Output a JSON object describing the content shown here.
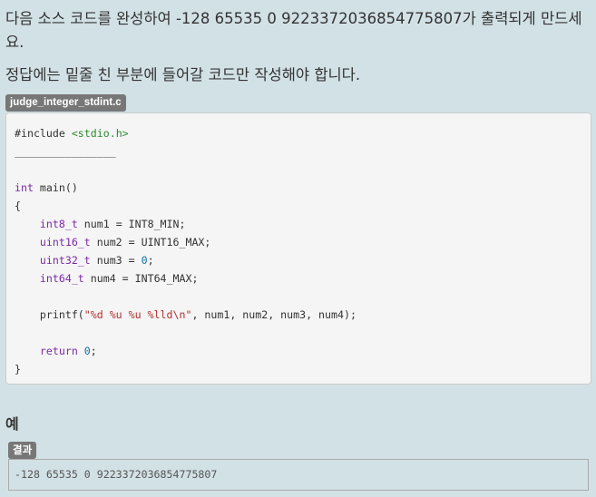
{
  "instructions": {
    "line1": "다음 소스 코드를 완성하여 -128 65535 0 9223372036854775807가 출력되게 만드세요.",
    "line2": "정답에는 밑줄 친 부분에 들어갈 코드만 작성해야 합니다."
  },
  "code_file": {
    "filename": "judge_integer_stdint.c",
    "lines": [
      [
        {
          "t": "pre",
          "v": "#include "
        },
        {
          "t": "inc",
          "v": "<stdio.h>"
        }
      ],
      [
        {
          "t": "blank",
          "v": "________________"
        }
      ],
      [],
      [
        {
          "t": "kw",
          "v": "int"
        },
        {
          "t": "plain",
          "v": " main()"
        }
      ],
      [
        {
          "t": "plain",
          "v": "{"
        }
      ],
      [
        {
          "t": "plain",
          "v": "    "
        },
        {
          "t": "type",
          "v": "int8_t"
        },
        {
          "t": "plain",
          "v": " num1 = INT8_MIN;"
        }
      ],
      [
        {
          "t": "plain",
          "v": "    "
        },
        {
          "t": "type",
          "v": "uint16_t"
        },
        {
          "t": "plain",
          "v": " num2 = UINT16_MAX;"
        }
      ],
      [
        {
          "t": "plain",
          "v": "    "
        },
        {
          "t": "type",
          "v": "uint32_t"
        },
        {
          "t": "plain",
          "v": " num3 = "
        },
        {
          "t": "num",
          "v": "0"
        },
        {
          "t": "plain",
          "v": ";"
        }
      ],
      [
        {
          "t": "plain",
          "v": "    "
        },
        {
          "t": "type",
          "v": "int64_t"
        },
        {
          "t": "plain",
          "v": " num4 = INT64_MAX;"
        }
      ],
      [],
      [
        {
          "t": "plain",
          "v": "    printf("
        },
        {
          "t": "str",
          "v": "\"%d %u %u %lld\\n\""
        },
        {
          "t": "plain",
          "v": ", num1, num2, num3, num4);"
        }
      ],
      [],
      [
        {
          "t": "plain",
          "v": "    "
        },
        {
          "t": "kw",
          "v": "return"
        },
        {
          "t": "plain",
          "v": " "
        },
        {
          "t": "num",
          "v": "0"
        },
        {
          "t": "plain",
          "v": ";"
        }
      ],
      [
        {
          "t": "plain",
          "v": "}"
        }
      ]
    ]
  },
  "example": {
    "heading": "예",
    "result_label": "결과",
    "output": "-128 65535 0 9223372036854775807"
  }
}
